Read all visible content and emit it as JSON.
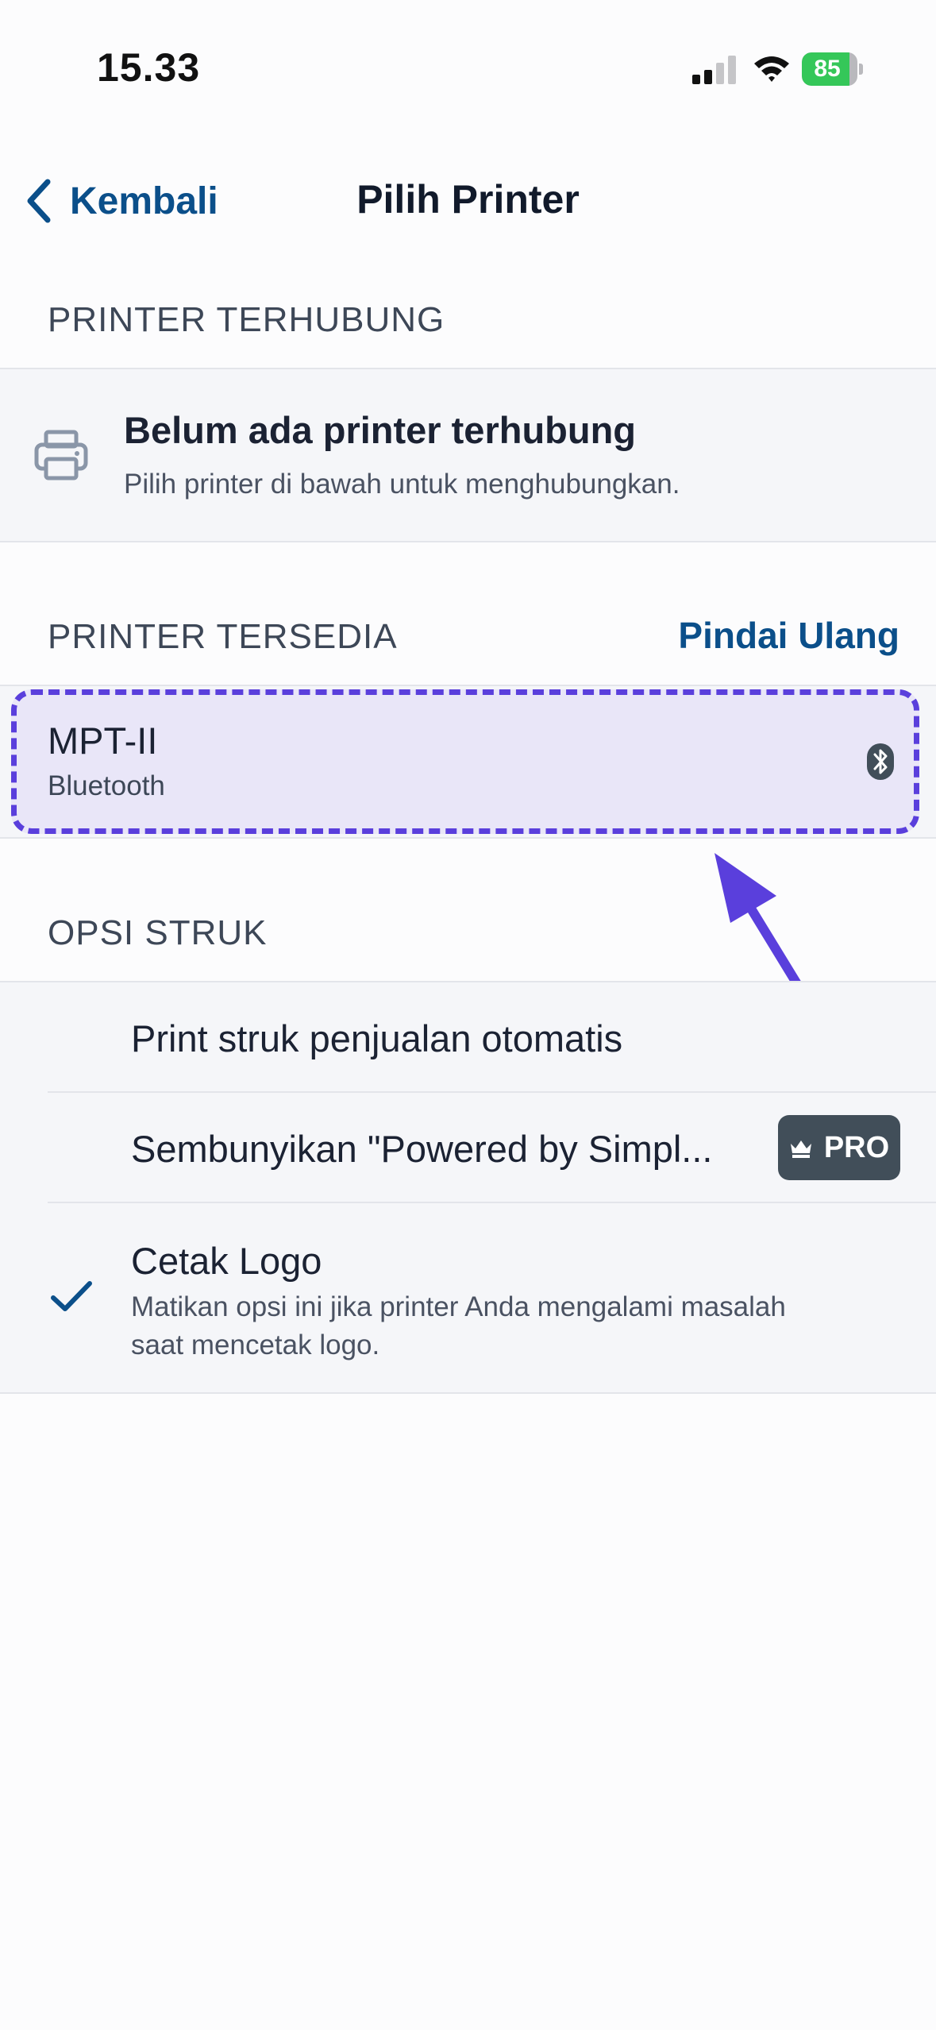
{
  "status_bar": {
    "time": "15.33",
    "battery_level": "85",
    "battery_fraction": 0.85,
    "battery_color": "#35c759"
  },
  "nav": {
    "back_label": "Kembali",
    "title": "Pilih Printer"
  },
  "connected_section": {
    "header": "PRINTER TERHUBUNG",
    "icon": "printer-icon",
    "title": "Belum ada printer terhubung",
    "subtitle": "Pilih printer di bawah untuk menghubungkan."
  },
  "available_section": {
    "header": "PRINTER TERSEDIA",
    "rescan_label": "Pindai Ulang",
    "printers": [
      {
        "name": "MPT-II",
        "type": "Bluetooth",
        "icon": "bluetooth-icon"
      }
    ]
  },
  "receipt_options": {
    "header": "OPSI STRUK",
    "items": [
      {
        "label": "Print struk penjualan otomatis",
        "checked": false
      },
      {
        "label": "Sembunyikan \"Powered by Simpl...",
        "checked": false,
        "badge": "PRO",
        "badge_icon": "crown-icon"
      },
      {
        "label": "Cetak Logo",
        "checked": true,
        "description": "Matikan opsi ini jika printer Anda mengalami masalah saat mencetak logo."
      }
    ]
  },
  "colors": {
    "accent": "#0b4f8a",
    "highlight_border": "#5a3fdc",
    "highlight_fill": "#e9e6f8",
    "badge_bg": "#414e59"
  }
}
